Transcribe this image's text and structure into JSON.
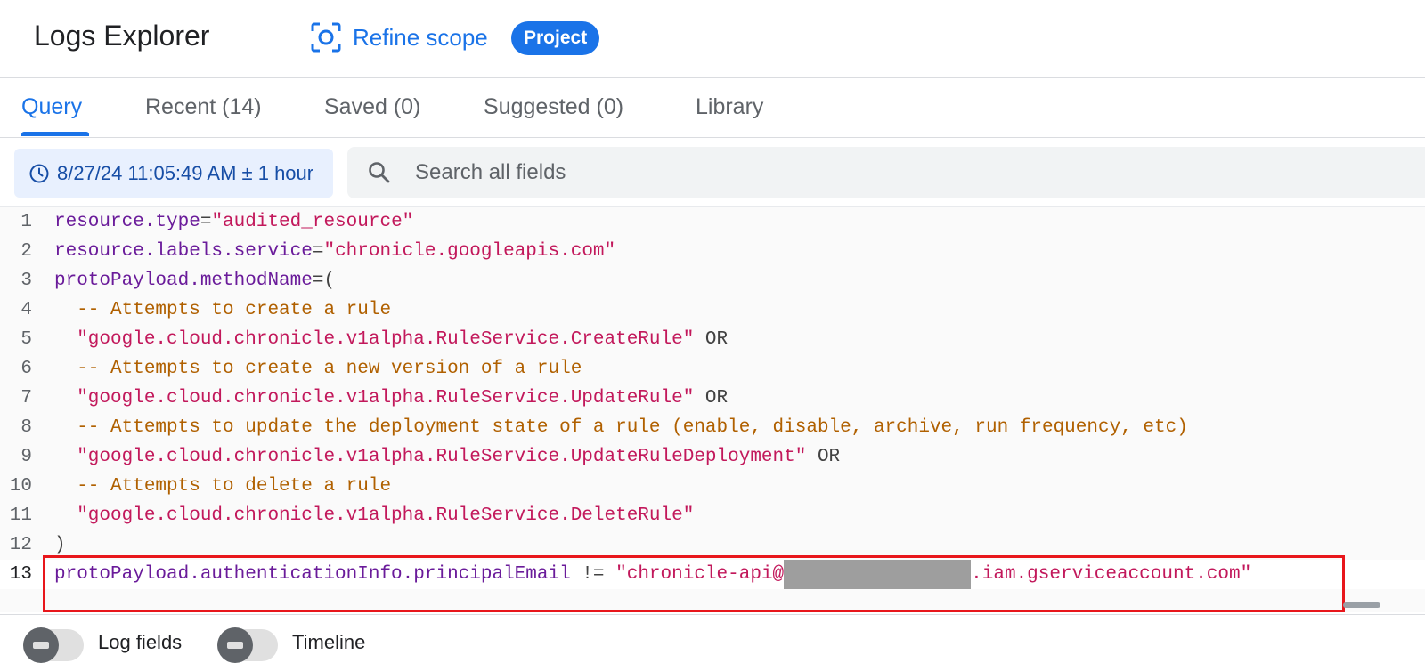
{
  "header": {
    "title": "Logs Explorer",
    "refine_label": "Refine scope",
    "scope_badge": "Project"
  },
  "tabs": [
    {
      "label": "Query",
      "active": true
    },
    {
      "label": "Recent (14)"
    },
    {
      "label": "Saved (0)"
    },
    {
      "label": "Suggested (0)"
    },
    {
      "label": "Library"
    }
  ],
  "time_range": "8/27/24 11:05:49 AM ± 1 hour",
  "search": {
    "placeholder": "Search all fields"
  },
  "query": {
    "lines": [
      {
        "n": "1",
        "tokens": [
          {
            "t": "k",
            "v": "resource.type"
          },
          {
            "t": "o",
            "v": "="
          },
          {
            "t": "s",
            "v": "\"audited_resource\""
          }
        ]
      },
      {
        "n": "2",
        "tokens": [
          {
            "t": "k",
            "v": "resource.labels.service"
          },
          {
            "t": "o",
            "v": "="
          },
          {
            "t": "s",
            "v": "\"chronicle.googleapis.com\""
          }
        ]
      },
      {
        "n": "3",
        "tokens": [
          {
            "t": "k",
            "v": "protoPayload.methodName"
          },
          {
            "t": "o",
            "v": "=("
          }
        ]
      },
      {
        "n": "4",
        "tokens": [
          {
            "t": "c",
            "v": "  -- Attempts to create a rule"
          }
        ]
      },
      {
        "n": "5",
        "tokens": [
          {
            "t": "s",
            "v": "  \"google.cloud.chronicle.v1alpha.RuleService.CreateRule\""
          },
          {
            "t": "o",
            "v": " OR"
          }
        ]
      },
      {
        "n": "6",
        "tokens": [
          {
            "t": "c",
            "v": "  -- Attempts to create a new version of a rule"
          }
        ]
      },
      {
        "n": "7",
        "tokens": [
          {
            "t": "s",
            "v": "  \"google.cloud.chronicle.v1alpha.RuleService.UpdateRule\""
          },
          {
            "t": "o",
            "v": " OR"
          }
        ]
      },
      {
        "n": "8",
        "tokens": [
          {
            "t": "c",
            "v": "  -- Attempts to update the deployment state of a rule (enable, disable, archive, run frequency, etc)"
          }
        ]
      },
      {
        "n": "9",
        "tokens": [
          {
            "t": "s",
            "v": "  \"google.cloud.chronicle.v1alpha.RuleService.UpdateRuleDeployment\""
          },
          {
            "t": "o",
            "v": " OR"
          }
        ]
      },
      {
        "n": "10",
        "tokens": [
          {
            "t": "c",
            "v": "  -- Attempts to delete a rule"
          }
        ]
      },
      {
        "n": "11",
        "tokens": [
          {
            "t": "s",
            "v": "  \"google.cloud.chronicle.v1alpha.RuleService.DeleteRule\""
          }
        ]
      },
      {
        "n": "12",
        "tokens": [
          {
            "t": "o",
            "v": ")"
          }
        ]
      },
      {
        "n": "13",
        "active": true,
        "tokens": [
          {
            "t": "k",
            "v": "protoPayload.authenticationInfo.principalEmail"
          },
          {
            "t": "o",
            "v": " != "
          },
          {
            "t": "s",
            "v": "\"chronicle-api@"
          },
          {
            "t": "redact",
            "v": ""
          },
          {
            "t": "s",
            "v": ".iam.gserviceaccount.com\""
          }
        ]
      }
    ]
  },
  "toggles": [
    {
      "label": "Log fields"
    },
    {
      "label": "Timeline"
    }
  ],
  "colors": {
    "accent": "#1a73e8",
    "highlight_border": "#e8161b",
    "keyword": "#6a1b9a",
    "string": "#c2185b",
    "comment": "#b06000"
  }
}
